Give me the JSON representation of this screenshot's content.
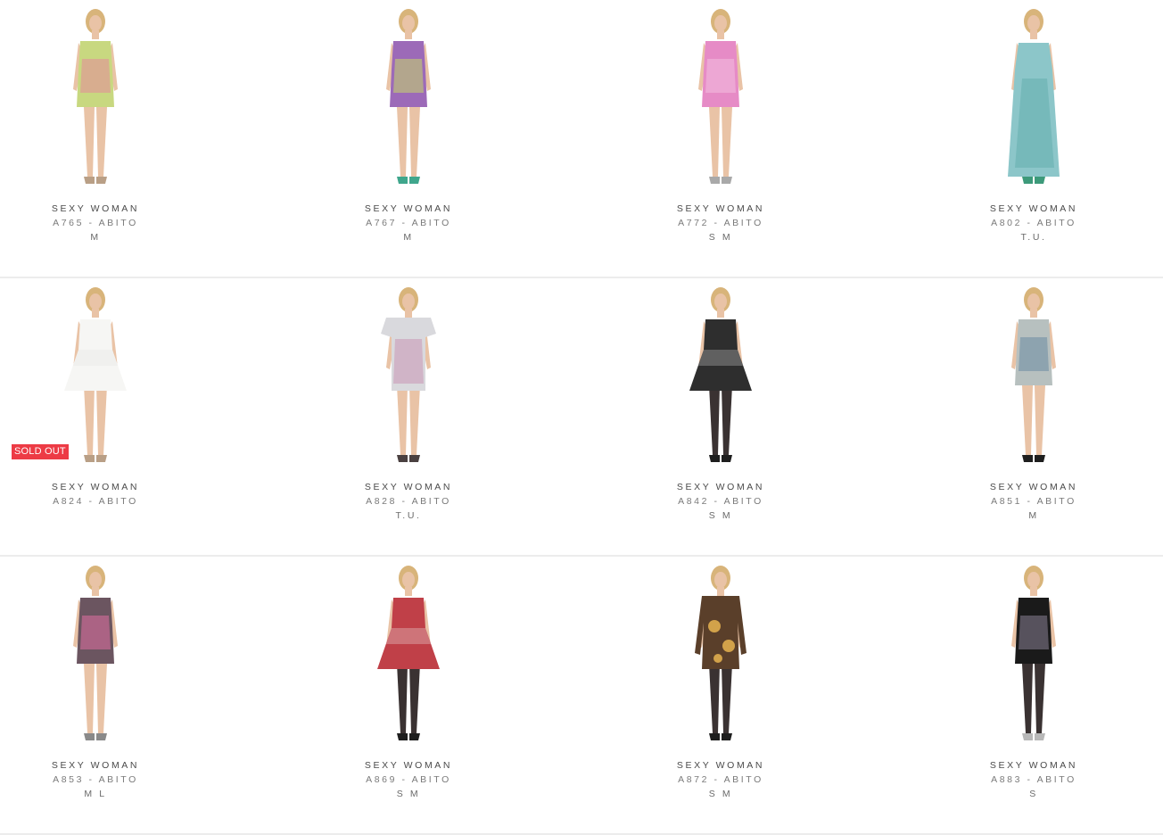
{
  "products": [
    {
      "brand": "SEXY WOMAN",
      "title": "A765 - ABITO",
      "sizes": "M",
      "dress_color": "#c8d880",
      "dress_accent": "#e58a9a",
      "shoes": "#b99f86",
      "style": "short",
      "bare_legs": true
    },
    {
      "brand": "SEXY WOMAN",
      "title": "A767 - ABITO",
      "sizes": "M",
      "dress_color": "#9c6ab8",
      "dress_accent": "#c7d76a",
      "shoes": "#3fa68c",
      "style": "short",
      "bare_legs": true
    },
    {
      "brand": "SEXY WOMAN",
      "title": "A772 - ABITO",
      "sizes": "S M",
      "dress_color": "#e68bc6",
      "dress_accent": "#f3bfe0",
      "shoes": "#a9a9a9",
      "style": "short",
      "bare_legs": true
    },
    {
      "brand": "SEXY WOMAN",
      "title": "A802 - ABITO",
      "sizes": "T.U.",
      "dress_color": "#8cc6c9",
      "dress_accent": "#5aa9a9",
      "shoes": "#3d9a7a",
      "style": "long",
      "bare_legs": true
    },
    {
      "brand": "SEXY WOMAN",
      "title": "A824 - ABITO",
      "sizes": "",
      "dress_color": "#f6f6f4",
      "dress_accent": "#e6e6e2",
      "shoes": "#b99f86",
      "style": "flare",
      "bare_legs": true
    },
    {
      "brand": "SEXY WOMAN",
      "title": "A828 - ABITO",
      "sizes": "T.U.",
      "dress_color": "#d9d9dd",
      "dress_accent": "#c896b4",
      "shoes": "#4a4040",
      "style": "tee",
      "bare_legs": true
    },
    {
      "brand": "SEXY WOMAN",
      "title": "A842 - ABITO",
      "sizes": "S M",
      "dress_color": "#2e2e2e",
      "dress_accent": "#bdbdbd",
      "shoes": "#1e1e1e",
      "style": "flare",
      "bare_legs": false
    },
    {
      "brand": "SEXY WOMAN",
      "title": "A851 - ABITO",
      "sizes": "M",
      "dress_color": "#b7c0bf",
      "dress_accent": "#6b8aa2",
      "shoes": "#1e1e1e",
      "style": "short",
      "bare_legs": true
    },
    {
      "brand": "SEXY WOMAN",
      "title": "A853 - ABITO",
      "sizes": "M L",
      "dress_color": "#6b5560",
      "dress_accent": "#e06fa3",
      "shoes": "#8a8a8a",
      "style": "short",
      "bare_legs": true
    },
    {
      "brand": "SEXY WOMAN",
      "title": "A869 - ABITO",
      "sizes": "S M",
      "dress_color": "#c04048",
      "dress_accent": "#e8d8d8",
      "shoes": "#1e1e1e",
      "style": "flare",
      "bare_legs": false
    },
    {
      "brand": "SEXY WOMAN",
      "title": "A872 - ABITO",
      "sizes": "S M",
      "dress_color": "#5a3f2a",
      "dress_accent": "#d2a24a",
      "shoes": "#1e1e1e",
      "style": "sleeve",
      "bare_legs": false
    },
    {
      "brand": "SEXY WOMAN",
      "title": "A883 - ABITO",
      "sizes": "S",
      "dress_color": "#1a1a1a",
      "dress_accent": "#8a8296",
      "shoes": "#b8b8b8",
      "style": "short",
      "bare_legs": false
    }
  ],
  "badges": {
    "sold_out": "SOLD OUT"
  }
}
